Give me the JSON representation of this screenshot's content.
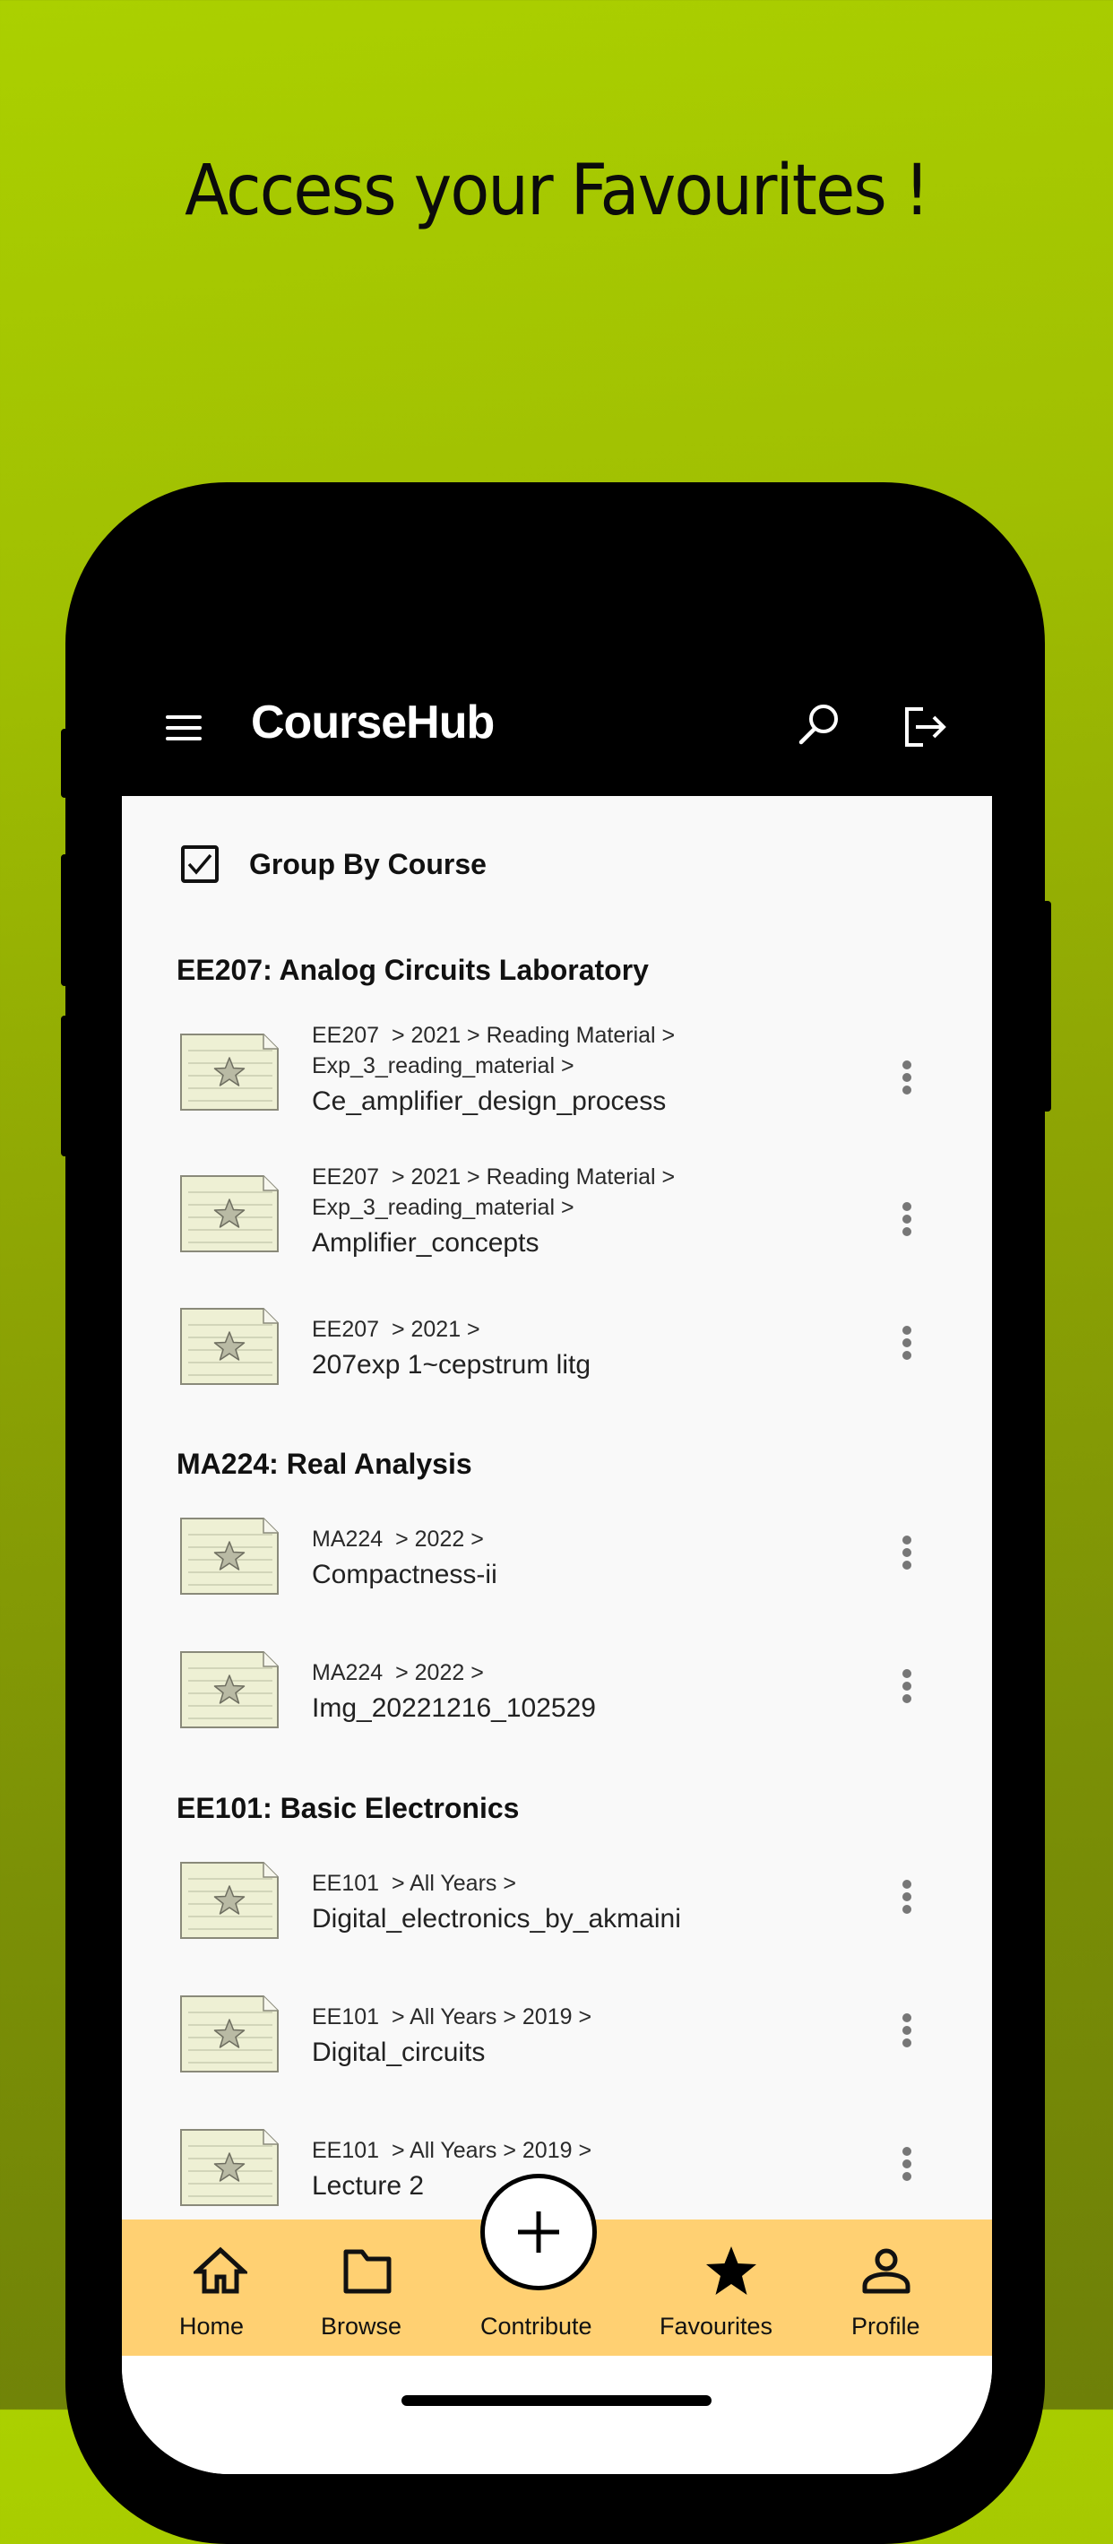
{
  "promo": {
    "title": "Access your Favourites !"
  },
  "appbar": {
    "title": "CourseHub",
    "menu_icon": "hamburger-menu-icon",
    "search_icon": "search-icon",
    "logout_icon": "logout-icon"
  },
  "group_toggle": {
    "label": "Group By Course",
    "checked": true
  },
  "sections": [
    {
      "title": "EE207: Analog Circuits Laboratory",
      "files": [
        {
          "path": "EE207  > 2021 > Reading Material >\nExp_3_reading_material >",
          "name": "Ce_amplifier_design_process"
        },
        {
          "path": "EE207  > 2021 > Reading Material >\nExp_3_reading_material >",
          "name": "Amplifier_concepts"
        },
        {
          "path": "EE207  > 2021 >",
          "name": "207exp 1~cepstrum litg"
        }
      ]
    },
    {
      "title": "MA224: Real Analysis",
      "files": [
        {
          "path": "MA224  > 2022 >",
          "name": "Compactness-ii"
        },
        {
          "path": "MA224  > 2022 >",
          "name": "Img_20221216_102529"
        }
      ]
    },
    {
      "title": "EE101: Basic Electronics",
      "files": [
        {
          "path": "EE101  > All Years >",
          "name": "Digital_electronics_by_akmaini"
        },
        {
          "path": "EE101  > All Years > 2019 >",
          "name": "Digital_circuits"
        },
        {
          "path": "EE101  > All Years > 2019 >",
          "name": "Lecture 2"
        }
      ]
    }
  ],
  "bottom_nav": {
    "items": [
      {
        "label": "Home",
        "icon": "home-icon"
      },
      {
        "label": "Browse",
        "icon": "folder-icon"
      },
      {
        "label": "Contribute",
        "icon": "plus-icon"
      },
      {
        "label": "Favourites",
        "icon": "star-icon",
        "active": true
      },
      {
        "label": "Profile",
        "icon": "person-icon"
      }
    ]
  },
  "colors": {
    "nav_background": "#ffd072",
    "content_background": "#f9f9f9",
    "appbar_background": "#000000",
    "file_icon_fill": "#eef0d4"
  }
}
